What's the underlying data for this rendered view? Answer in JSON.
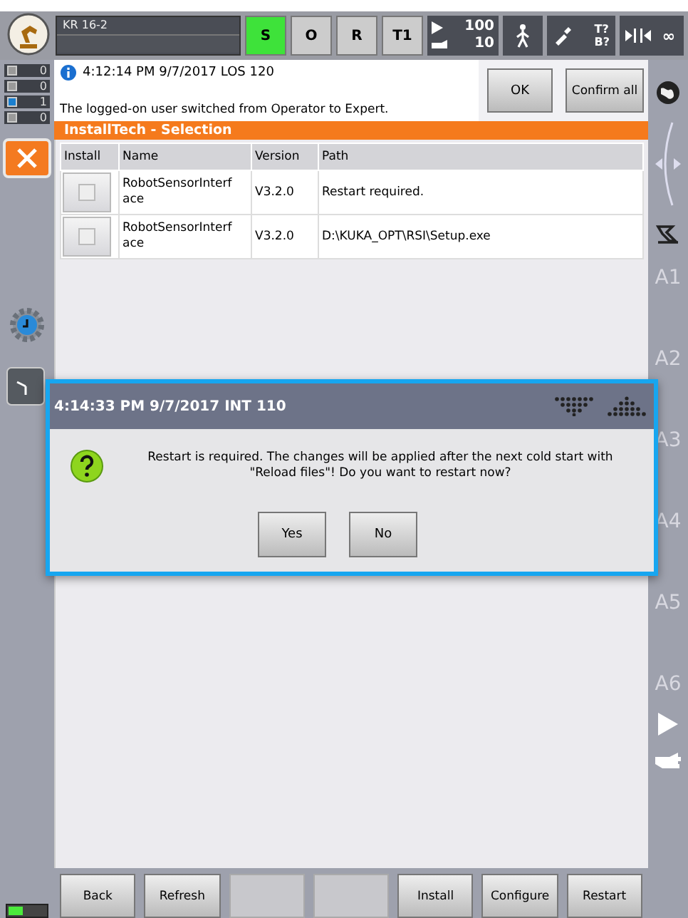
{
  "top_bar": {
    "robot_name": "KR 16-2",
    "modes": [
      {
        "label": "S",
        "selected": true
      },
      {
        "label": "O",
        "selected": false
      },
      {
        "label": "R",
        "selected": false
      },
      {
        "label": "T1",
        "selected": false
      }
    ],
    "override": "100",
    "jog_override": "10",
    "tool": "T?",
    "base": "B?",
    "increment": "∞"
  },
  "message_counts": [
    {
      "kind": "ack",
      "count": "0"
    },
    {
      "kind": "state",
      "count": "0"
    },
    {
      "kind": "info",
      "count": "1"
    },
    {
      "kind": "wait",
      "count": "0"
    }
  ],
  "message": {
    "header": "4:12:14 PM 9/7/2017 LOS 120",
    "text": "The logged-on user switched from Operator to Expert.",
    "buttons": [
      "OK",
      "Confirm all"
    ]
  },
  "panel_title": "InstallTech - Selection",
  "table": {
    "columns": [
      "Install",
      "Name",
      "Version",
      "Path"
    ],
    "rows": [
      {
        "checked": false,
        "name": "RobotSensorInterf ace",
        "version": "V3.2.0",
        "path": "Restart required."
      },
      {
        "checked": false,
        "name": "RobotSensorInterf ace",
        "version": "V3.2.0",
        "path": "D:\\KUKA_OPT\\RSI\\Setup.exe"
      }
    ]
  },
  "dialog": {
    "header": "4:14:33 PM 9/7/2017 INT 110",
    "text": "Restart is required. The changes will be applied after the next cold start with \"Reload files\"! Do you want to restart now?",
    "buttons": [
      "Yes",
      "No"
    ]
  },
  "axes": [
    "A1",
    "A2",
    "A3",
    "A4",
    "A5",
    "A6"
  ],
  "bottom_buttons": [
    {
      "kind": "button",
      "label": "Back"
    },
    {
      "kind": "button",
      "label": "Refresh"
    },
    {
      "kind": "empty"
    },
    {
      "kind": "empty"
    },
    {
      "kind": "button",
      "label": "Install"
    },
    {
      "kind": "button",
      "label": "Configure"
    },
    {
      "kind": "button",
      "label": "Restart"
    }
  ]
}
